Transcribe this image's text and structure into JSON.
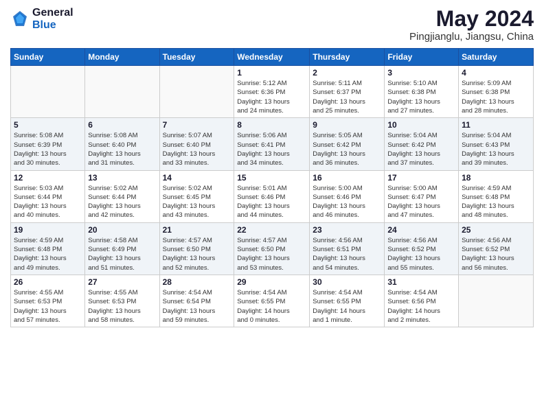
{
  "logo": {
    "text_general": "General",
    "text_blue": "Blue"
  },
  "title": "May 2024",
  "subtitle": "Pingjianglu, Jiangsu, China",
  "days_of_week": [
    "Sunday",
    "Monday",
    "Tuesday",
    "Wednesday",
    "Thursday",
    "Friday",
    "Saturday"
  ],
  "weeks": [
    {
      "shade": false,
      "days": [
        {
          "num": "",
          "info": ""
        },
        {
          "num": "",
          "info": ""
        },
        {
          "num": "",
          "info": ""
        },
        {
          "num": "1",
          "info": "Sunrise: 5:12 AM\nSunset: 6:36 PM\nDaylight: 13 hours\nand 24 minutes."
        },
        {
          "num": "2",
          "info": "Sunrise: 5:11 AM\nSunset: 6:37 PM\nDaylight: 13 hours\nand 25 minutes."
        },
        {
          "num": "3",
          "info": "Sunrise: 5:10 AM\nSunset: 6:38 PM\nDaylight: 13 hours\nand 27 minutes."
        },
        {
          "num": "4",
          "info": "Sunrise: 5:09 AM\nSunset: 6:38 PM\nDaylight: 13 hours\nand 28 minutes."
        }
      ]
    },
    {
      "shade": true,
      "days": [
        {
          "num": "5",
          "info": "Sunrise: 5:08 AM\nSunset: 6:39 PM\nDaylight: 13 hours\nand 30 minutes."
        },
        {
          "num": "6",
          "info": "Sunrise: 5:08 AM\nSunset: 6:40 PM\nDaylight: 13 hours\nand 31 minutes."
        },
        {
          "num": "7",
          "info": "Sunrise: 5:07 AM\nSunset: 6:40 PM\nDaylight: 13 hours\nand 33 minutes."
        },
        {
          "num": "8",
          "info": "Sunrise: 5:06 AM\nSunset: 6:41 PM\nDaylight: 13 hours\nand 34 minutes."
        },
        {
          "num": "9",
          "info": "Sunrise: 5:05 AM\nSunset: 6:42 PM\nDaylight: 13 hours\nand 36 minutes."
        },
        {
          "num": "10",
          "info": "Sunrise: 5:04 AM\nSunset: 6:42 PM\nDaylight: 13 hours\nand 37 minutes."
        },
        {
          "num": "11",
          "info": "Sunrise: 5:04 AM\nSunset: 6:43 PM\nDaylight: 13 hours\nand 39 minutes."
        }
      ]
    },
    {
      "shade": false,
      "days": [
        {
          "num": "12",
          "info": "Sunrise: 5:03 AM\nSunset: 6:44 PM\nDaylight: 13 hours\nand 40 minutes."
        },
        {
          "num": "13",
          "info": "Sunrise: 5:02 AM\nSunset: 6:44 PM\nDaylight: 13 hours\nand 42 minutes."
        },
        {
          "num": "14",
          "info": "Sunrise: 5:02 AM\nSunset: 6:45 PM\nDaylight: 13 hours\nand 43 minutes."
        },
        {
          "num": "15",
          "info": "Sunrise: 5:01 AM\nSunset: 6:46 PM\nDaylight: 13 hours\nand 44 minutes."
        },
        {
          "num": "16",
          "info": "Sunrise: 5:00 AM\nSunset: 6:46 PM\nDaylight: 13 hours\nand 46 minutes."
        },
        {
          "num": "17",
          "info": "Sunrise: 5:00 AM\nSunset: 6:47 PM\nDaylight: 13 hours\nand 47 minutes."
        },
        {
          "num": "18",
          "info": "Sunrise: 4:59 AM\nSunset: 6:48 PM\nDaylight: 13 hours\nand 48 minutes."
        }
      ]
    },
    {
      "shade": true,
      "days": [
        {
          "num": "19",
          "info": "Sunrise: 4:59 AM\nSunset: 6:48 PM\nDaylight: 13 hours\nand 49 minutes."
        },
        {
          "num": "20",
          "info": "Sunrise: 4:58 AM\nSunset: 6:49 PM\nDaylight: 13 hours\nand 51 minutes."
        },
        {
          "num": "21",
          "info": "Sunrise: 4:57 AM\nSunset: 6:50 PM\nDaylight: 13 hours\nand 52 minutes."
        },
        {
          "num": "22",
          "info": "Sunrise: 4:57 AM\nSunset: 6:50 PM\nDaylight: 13 hours\nand 53 minutes."
        },
        {
          "num": "23",
          "info": "Sunrise: 4:56 AM\nSunset: 6:51 PM\nDaylight: 13 hours\nand 54 minutes."
        },
        {
          "num": "24",
          "info": "Sunrise: 4:56 AM\nSunset: 6:52 PM\nDaylight: 13 hours\nand 55 minutes."
        },
        {
          "num": "25",
          "info": "Sunrise: 4:56 AM\nSunset: 6:52 PM\nDaylight: 13 hours\nand 56 minutes."
        }
      ]
    },
    {
      "shade": false,
      "days": [
        {
          "num": "26",
          "info": "Sunrise: 4:55 AM\nSunset: 6:53 PM\nDaylight: 13 hours\nand 57 minutes."
        },
        {
          "num": "27",
          "info": "Sunrise: 4:55 AM\nSunset: 6:53 PM\nDaylight: 13 hours\nand 58 minutes."
        },
        {
          "num": "28",
          "info": "Sunrise: 4:54 AM\nSunset: 6:54 PM\nDaylight: 13 hours\nand 59 minutes."
        },
        {
          "num": "29",
          "info": "Sunrise: 4:54 AM\nSunset: 6:55 PM\nDaylight: 14 hours\nand 0 minutes."
        },
        {
          "num": "30",
          "info": "Sunrise: 4:54 AM\nSunset: 6:55 PM\nDaylight: 14 hours\nand 1 minute."
        },
        {
          "num": "31",
          "info": "Sunrise: 4:54 AM\nSunset: 6:56 PM\nDaylight: 14 hours\nand 2 minutes."
        },
        {
          "num": "",
          "info": ""
        }
      ]
    }
  ]
}
